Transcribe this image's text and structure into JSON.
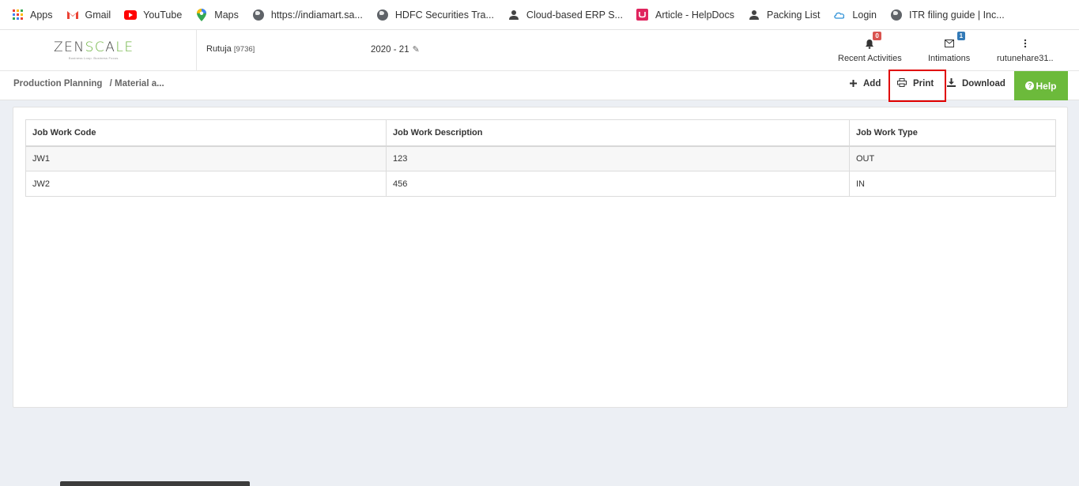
{
  "bookmarks": [
    {
      "label": "Apps",
      "icon": "apps-grid-icon"
    },
    {
      "label": "Gmail",
      "icon": "gmail-icon"
    },
    {
      "label": "YouTube",
      "icon": "youtube-icon"
    },
    {
      "label": "Maps",
      "icon": "maps-pin-icon"
    },
    {
      "label": "https://indiamart.sa...",
      "icon": "globe-icon"
    },
    {
      "label": "HDFC Securities Tra...",
      "icon": "globe-icon"
    },
    {
      "label": "Cloud-based ERP S...",
      "icon": "user-icon"
    },
    {
      "label": "Article - HelpDocs",
      "icon": "helpdocs-icon"
    },
    {
      "label": "Packing List",
      "icon": "user-icon"
    },
    {
      "label": "Login",
      "icon": "cloud-icon"
    },
    {
      "label": "ITR filing guide | Inc...",
      "icon": "globe-icon"
    }
  ],
  "header": {
    "logo_text_a": "ZEN",
    "logo_text_b": "SC",
    "logo_text_c": "A",
    "logo_text_d": "LE",
    "logo_tagline": "Business Loop. Business Focus.",
    "user_name": "Rutuja",
    "user_code": "[9736]",
    "fiscal_year": "2020 - 21",
    "recent_activities_label": "Recent Activities",
    "recent_activities_count": "0",
    "intimations_label": "Intimations",
    "intimations_count": "1",
    "account_label": "rutunehare31.."
  },
  "toolbar": {
    "breadcrumb_root": "Production Planning",
    "breadcrumb_current": "/ Material a...",
    "add_label": "Add",
    "print_label": "Print",
    "download_label": "Download",
    "help_label": "Help"
  },
  "table": {
    "columns": [
      "Job Work Code",
      "Job Work Description",
      "Job Work Type"
    ],
    "rows": [
      [
        "JW1",
        "123",
        "OUT"
      ],
      [
        "JW2",
        "456",
        "IN"
      ]
    ]
  },
  "colors": {
    "accent_green": "#6cba3b",
    "highlight_red": "#e00000",
    "badge_red": "#d9534f",
    "badge_blue": "#337ab7"
  }
}
